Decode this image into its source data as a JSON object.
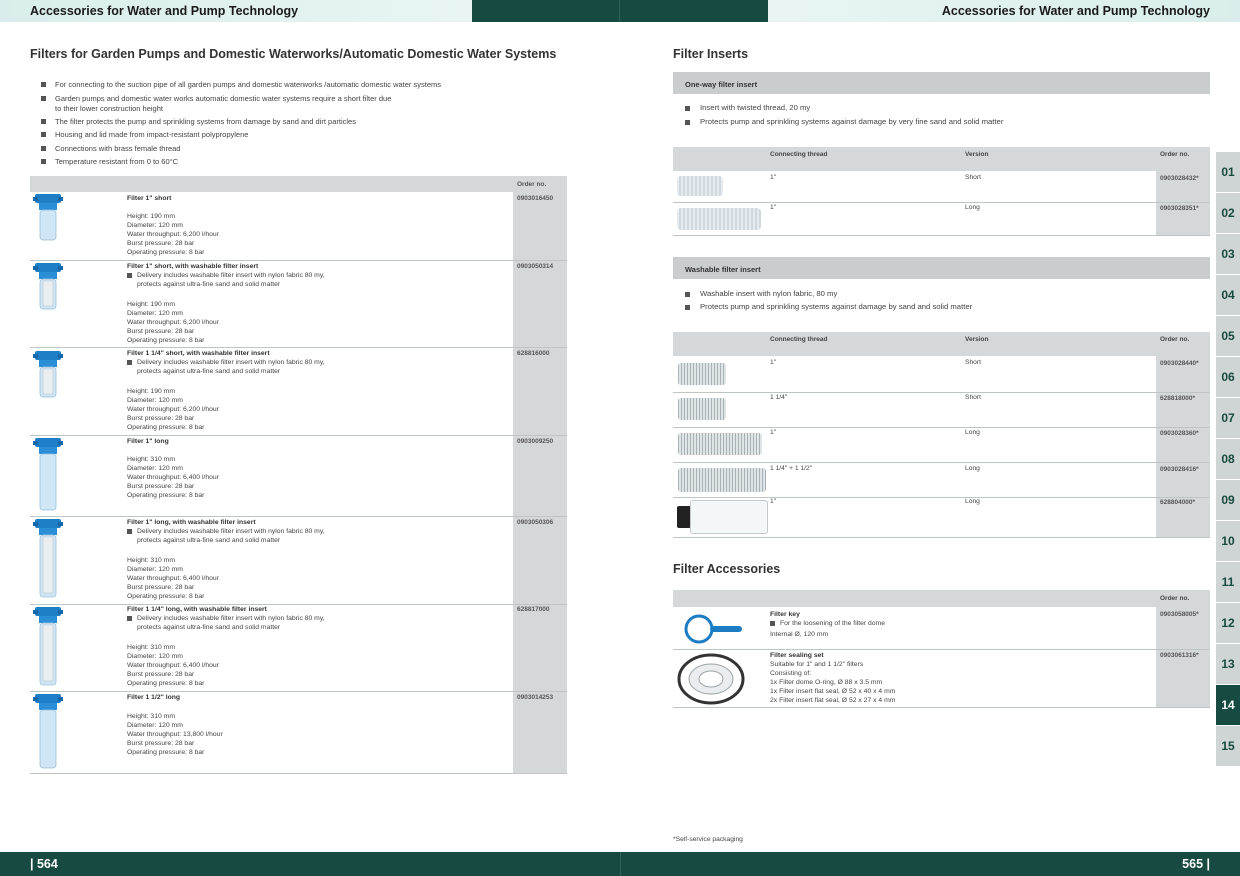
{
  "header": {
    "left": "Accessories for Water and Pump Technology",
    "right": "Accessories for Water and Pump Technology"
  },
  "footer": {
    "left": "| 564",
    "right": "565 |"
  },
  "left": {
    "title": "Filters for Garden Pumps and Domestic Waterworks/Automatic Domestic Water Systems",
    "bullets": [
      "For connecting to the suction pipe of all garden pumps and domestic waterworks /automatic domestic water systems",
      "Garden pumps and domestic water works automatic domestic water systems require a short filter due\nto their lower construction height",
      "The filter protects the pump and sprinkling systems from damage by sand and dirt particles",
      "Housing and lid made from impact-resistant polypropylene",
      "Connections with brass female thread",
      "Temperature resistant from 0 to 60°C"
    ],
    "order_header": "Order no.",
    "products": [
      {
        "name": "Filter 1\" short",
        "bullet": "",
        "specs": "Height: 190 mm\nDiameter: 120 mm\nWater throughput: 6,200 l/hour\nBurst pressure: 28 bar\nOperating pressure: 8 bar",
        "order": "0903016450"
      },
      {
        "name": "Filter 1\" short, with washable filter insert",
        "bullet": "Delivery includes washable filter insert with nylon fabric 80 my,\nprotects against ultra-fine sand and solid matter",
        "specs": "Height: 190 mm\nDiameter: 120 mm\nWater throughput: 6,200 l/hour\nBurst pressure: 28 bar\nOperating pressure: 8 bar",
        "order": "0903050314"
      },
      {
        "name": "Filter 1 1/4\" short, with washable filter insert",
        "bullet": "Delivery includes washable filter insert with nylon fabric 80 my,\nprotects against ultra-fine sand and solid matter",
        "specs": "Height: 190 mm\nDiameter: 120 mm\nWater throughput: 6,200 l/hour\nBurst pressure: 28 bar\nOperating pressure: 8 bar",
        "order": "628816000"
      },
      {
        "name": "Filter 1\" long",
        "bullet": "",
        "specs": "Height: 310 mm\nDiameter: 120 mm\nWater throughput: 6,400 l/hour\nBurst pressure: 28 bar\nOperating pressure: 8 bar",
        "order": "0903009250"
      },
      {
        "name": "Filter 1\" long, with washable filter insert",
        "bullet": "Delivery includes washable filter insert with nylon fabric 80 my,\nprotects against ultra-fine sand and solid matter",
        "specs": "Height: 310 mm\nDiameter: 120 mm\nWater throughput: 6,400 l/hour\nBurst pressure: 28 bar\nOperating pressure: 8 bar",
        "order": "0903050306"
      },
      {
        "name": "Filter 1 1/4\" long, with washable filter insert",
        "bullet": "Delivery includes washable filter insert with nylon fabric 80 my,\nprotects against ultra-fine sand and solid matter",
        "specs": "Height: 310 mm\nDiameter: 120 mm\nWater throughput: 6,400 l/hour\nBurst pressure: 28 bar\nOperating pressure: 8 bar",
        "order": "628817000"
      },
      {
        "name": "Filter 1 1/2\" long",
        "bullet": "",
        "specs": "Height: 310 mm\nDiameter: 120 mm\nWater throughput: 13,800 l/hour\nBurst pressure: 28 bar\nOperating pressure: 8 bar",
        "order": "0903014253"
      }
    ]
  },
  "right": {
    "inserts_title": "Filter Inserts",
    "oneway": {
      "head": "One-way filter insert",
      "bullets": [
        "Insert with twisted thread, 20 my",
        "Protects pump and sprinkling systems against damage by very fine sand and solid matter"
      ],
      "cols": [
        "Connecting thread",
        "Version",
        "Order no."
      ],
      "rows": [
        {
          "thread": "1\"",
          "version": "Short",
          "order": "0903028432*"
        },
        {
          "thread": "1\"",
          "version": "Long",
          "order": "0903028351*"
        }
      ]
    },
    "washable": {
      "head": "Washable filter insert",
      "bullets": [
        "Washable insert with nylon fabric, 80 my",
        "Protects pump and sprinkling systems against damage by sand and solid matter"
      ],
      "cols": [
        "Connecting thread",
        "Version",
        "Order no."
      ],
      "rows": [
        {
          "thread": "1\"",
          "version": "Short",
          "order": "0903028440*"
        },
        {
          "thread": "1 1/4\"",
          "version": "Short",
          "order": "628818000*"
        },
        {
          "thread": "1\"",
          "version": "Long",
          "order": "0903028360*"
        },
        {
          "thread": "1 1/4\" + 1 1/2\"",
          "version": "Long",
          "order": "0903028416*"
        },
        {
          "thread": "1\"",
          "version": "Long",
          "order": "628804000*"
        }
      ]
    },
    "acc_title": "Filter Accessories",
    "acc_order_header": "Order no.",
    "acc": [
      {
        "name": "Filter key",
        "bullet": "For the loosening of the filter dome",
        "desc": "Internal Ø, 120 mm",
        "order": "0903058005*"
      },
      {
        "name": "Filter sealing set",
        "bullet": "",
        "desc": "Suitable for 1\" and 1 1/2\" filters\nConsisting of:\n1x Filter dome O-ring, Ø 88 x 3.5 mm\n1x Filter insert flat seal, Ø 52 x 40 x 4 mm\n2x Filter insert flat seal, Ø 52 x 27 x 4 mm",
        "order": "0903061316*"
      }
    ],
    "footnote": "*Self-service packaging"
  },
  "tabs": [
    "01",
    "02",
    "03",
    "04",
    "05",
    "06",
    "07",
    "08",
    "09",
    "10",
    "11",
    "12",
    "13",
    "14",
    "15"
  ],
  "active_tab": "14"
}
